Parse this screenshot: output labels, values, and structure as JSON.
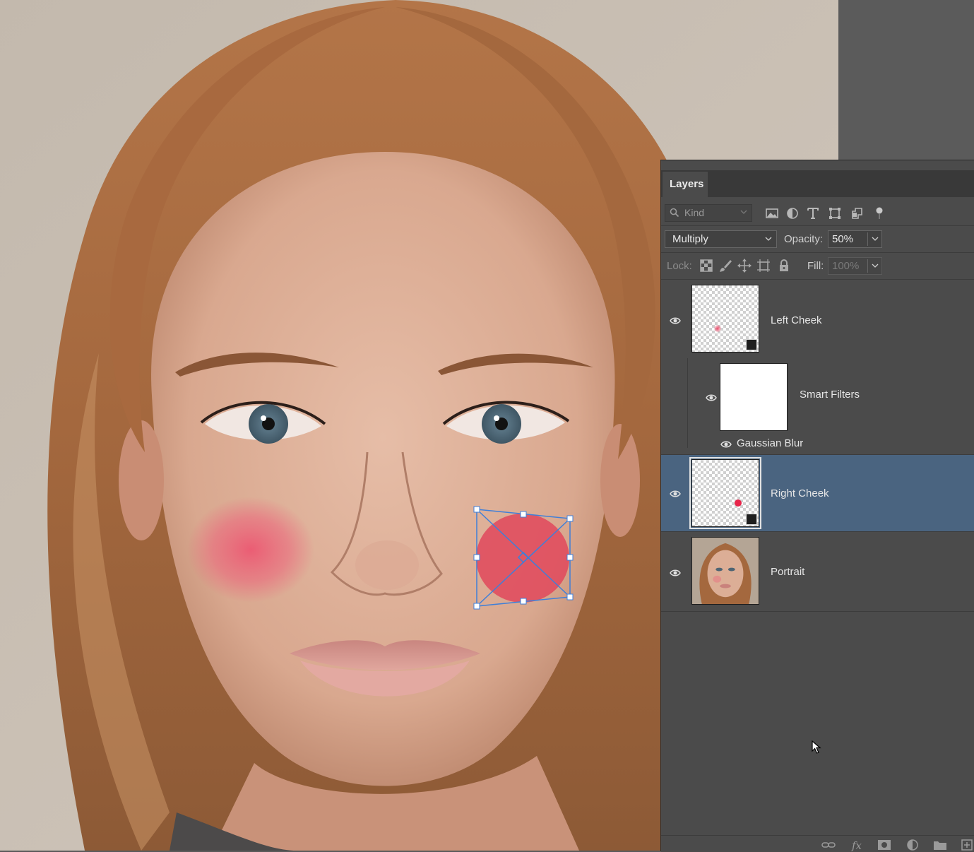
{
  "panel": {
    "tab": "Layers",
    "kind_placeholder": "Kind",
    "blend_mode": "Multiply",
    "opacity_label": "Opacity:",
    "opacity_value": "50%",
    "lock_label": "Lock:",
    "fill_label": "Fill:",
    "fill_value": "100%"
  },
  "filter_icons": [
    "image-filter-icon",
    "adjustment-filter-icon",
    "type-filter-icon",
    "shape-filter-icon",
    "smart-object-filter-icon",
    "filter-toggle-icon"
  ],
  "lock_icons": [
    "lock-transparent-pixels-icon",
    "lock-image-pixels-icon",
    "lock-position-icon",
    "lock-artboard-icon",
    "lock-all-icon"
  ],
  "layers": [
    {
      "name": "Left Cheek",
      "visible": true,
      "selected": false,
      "type": "smart-object"
    },
    {
      "name": "Smart Filters",
      "visible": true,
      "child": true
    },
    {
      "name": "Gaussian Blur",
      "visible": true,
      "child": true
    },
    {
      "name": "Right Cheek",
      "visible": true,
      "selected": true,
      "type": "smart-object"
    },
    {
      "name": "Portrait",
      "visible": true,
      "selected": false,
      "type": "image"
    }
  ],
  "bottom_icons": [
    "link-layers-icon",
    "fx-icon",
    "add-mask-icon",
    "new-adjustment-icon",
    "new-group-icon",
    "new-layer-icon"
  ],
  "colors": {
    "panel_bg": "#4b4b4b",
    "selected_row": "#4a6480",
    "transform_handle": "#3f7fd8",
    "blush": "#e0485c"
  }
}
